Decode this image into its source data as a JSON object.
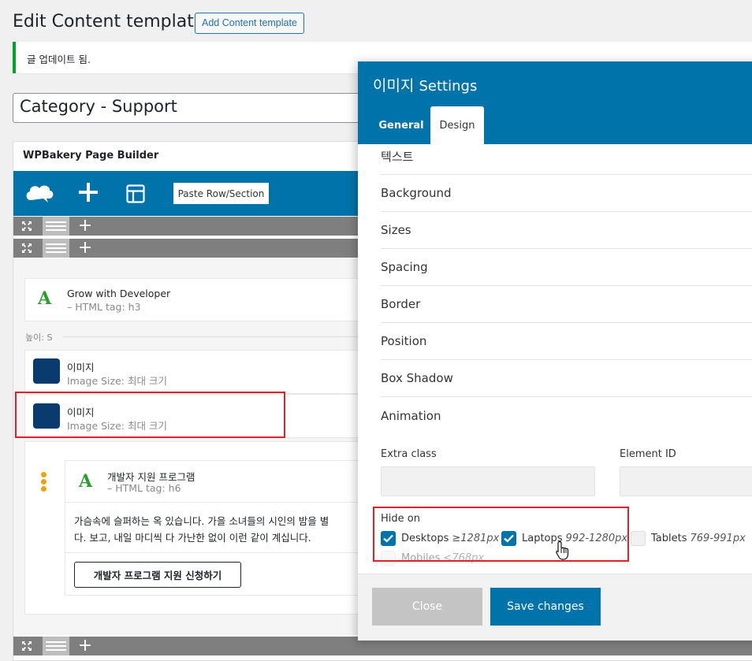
{
  "header": {
    "title": "Edit Content template",
    "add_button": "Add Content template"
  },
  "notice": "글 업데이트 됨.",
  "post_title": "Category - Support",
  "builder": {
    "title": "WPBakery Page Builder",
    "paste_button": "Paste Row/Section",
    "height_label": "높이: S",
    "elements": [
      {
        "name": "Grow with Developer",
        "sub": "– HTML tag: h3"
      },
      {
        "name": "이미지",
        "sub": "Image Size: 최대 크기"
      },
      {
        "name": "이미지",
        "sub": "Image Size: 최대 크기"
      }
    ],
    "inner": {
      "name": "개발자 지원 프로그램",
      "sub": "– HTML tag: h6",
      "text_lines": [
        "가슴속에 슬퍼하는 옥 있습니다. 가을 소녀들의 시인의 밤을 별",
        "다. 보고, 내일 마디씩 다 가난한 없이 이런 같이 계십니다."
      ],
      "button": "개발자 프로그램 지원 신청하기"
    }
  },
  "modal": {
    "title_korean": "이미지",
    "title_suffix": "Settings",
    "tabs": [
      "General",
      "Design"
    ],
    "sections": [
      "텍스트",
      "Background",
      "Sizes",
      "Spacing",
      "Border",
      "Position",
      "Box Shadow",
      "Animation"
    ],
    "extra_class_label": "Extra class",
    "element_id_label": "Element ID",
    "hide_on": {
      "label": "Hide on",
      "options": [
        {
          "label": "Desktops",
          "range": "≥1281px",
          "checked": true
        },
        {
          "label": "Laptops",
          "range": "992-1280px",
          "checked": true
        },
        {
          "label": "Tablets",
          "range": "769-991px",
          "checked": false
        },
        {
          "label": "Mobiles",
          "range": "<768px",
          "checked": false
        }
      ]
    },
    "close_button": "Close",
    "save_button": "Save changes"
  },
  "colors": {
    "accent": "#0073aa",
    "highlight": "#e0202a",
    "notice_border": "#00a32a"
  }
}
